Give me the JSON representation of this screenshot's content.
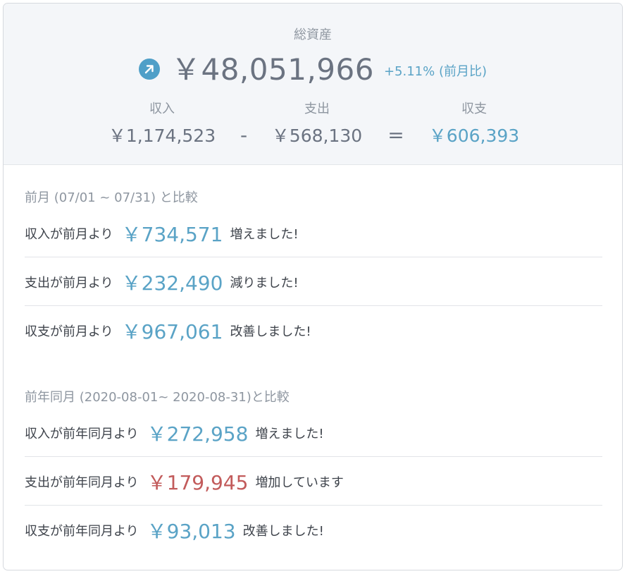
{
  "summary": {
    "total_label": "総資産",
    "total_amount": "￥48,051,966",
    "total_change": "+5.11% (前月比)",
    "income_label": "収入",
    "income_value": "￥1,174,523",
    "minus_symbol": "-",
    "expense_label": "支出",
    "expense_value": "￥568,130",
    "equals_symbol": "=",
    "balance_label": "収支",
    "balance_value": "￥606,393",
    "trend_icon": "arrow-up-right-icon"
  },
  "prev_month": {
    "title": "前月 (07/01 ~ 07/31) と比較",
    "rows": [
      {
        "prefix": "収入が前月より",
        "amount": "￥734,571",
        "suffix": "増えました!",
        "status": "good"
      },
      {
        "prefix": "支出が前月より",
        "amount": "￥232,490",
        "suffix": "減りました!",
        "status": "good"
      },
      {
        "prefix": "収支が前月より",
        "amount": "￥967,061",
        "suffix": "改善しました!",
        "status": "good"
      }
    ]
  },
  "prev_year": {
    "title": "前年同月 (2020-08-01~ 2020-08-31)と比較",
    "rows": [
      {
        "prefix": "収入が前年同月より",
        "amount": "￥272,958",
        "suffix": "増えました!",
        "status": "good"
      },
      {
        "prefix": "支出が前年同月より",
        "amount": "￥179,945",
        "suffix": "増加しています",
        "status": "bad"
      },
      {
        "prefix": "収支が前年同月より",
        "amount": "￥93,013",
        "suffix": "改善しました!",
        "status": "good"
      }
    ]
  },
  "colors": {
    "positive": "#5aa3c6",
    "negative": "#c25b5b",
    "muted": "#8e96a0",
    "text": "#3e434b",
    "summary_bg": "#f4f6f9"
  }
}
